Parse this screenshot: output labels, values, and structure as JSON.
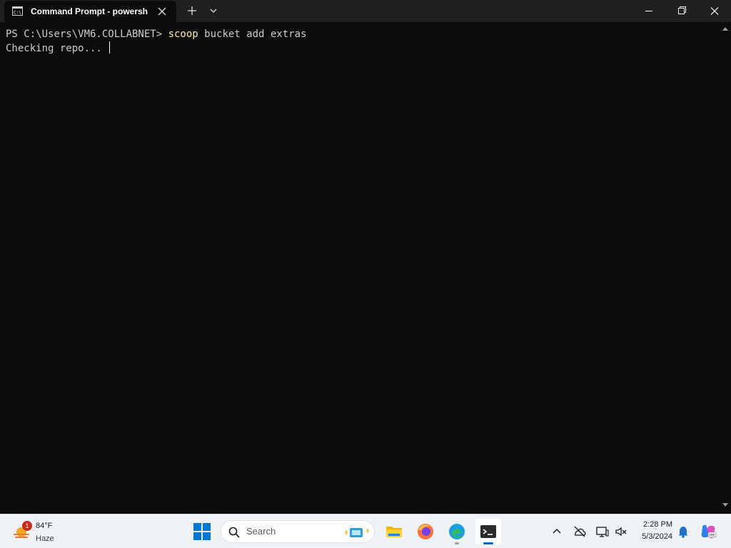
{
  "window": {
    "tab_title": "Command Prompt - powershell"
  },
  "terminal": {
    "prompt": "PS C:\\Users\\VM6.COLLABNET> ",
    "command": "scoop",
    "args": " bucket add extras",
    "output": "Checking repo... "
  },
  "colors": {
    "terminal_bg": "#0c0c0c",
    "terminal_text": "#cccccc",
    "command_text": "#f9f1a5",
    "titlebar_bg": "#202020",
    "taskbar_bg": "#eef2f6",
    "accent": "#0067c0"
  },
  "taskbar": {
    "weather": {
      "temp": "84°F",
      "condition": "Haze",
      "badge": "1"
    },
    "search": {
      "label": "Search"
    },
    "apps": [
      "file-explorer-icon",
      "firefox-icon",
      "edge-icon",
      "terminal-icon"
    ],
    "clock": {
      "time": "2:28 PM",
      "date": "5/3/2024"
    }
  }
}
